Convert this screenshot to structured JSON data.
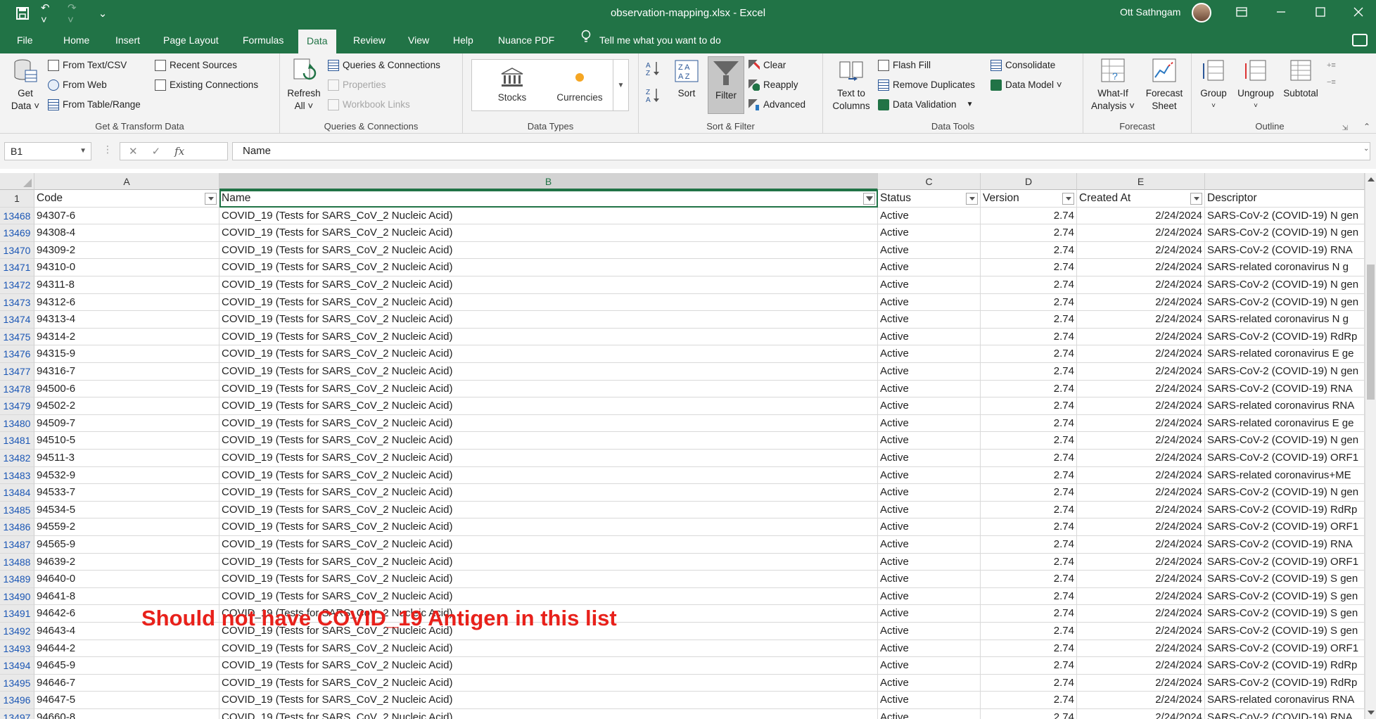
{
  "titlebar": {
    "document_title": "observation-mapping.xlsx  -  Excel",
    "user_name": "Ott Sathngam",
    "qat_icons": [
      "save-icon",
      "undo-icon",
      "redo-icon",
      "customize-qat-icon"
    ]
  },
  "tabs": [
    "File",
    "Home",
    "Insert",
    "Page Layout",
    "Formulas",
    "Data",
    "Review",
    "View",
    "Help",
    "Nuance PDF"
  ],
  "active_tab": "Data",
  "tell_me": "Tell me what you want to do",
  "ribbon": {
    "get_transform": {
      "get_data_line1": "Get",
      "get_data_line2": "Data ˅",
      "from_text_csv": "From Text/CSV",
      "from_web": "From Web",
      "from_table_range": "From Table/Range",
      "recent_sources": "Recent Sources",
      "existing_connections": "Existing Connections",
      "label": "Get & Transform Data"
    },
    "queries": {
      "refresh_line1": "Refresh",
      "refresh_line2": "All ˅",
      "queries_connections": "Queries & Connections",
      "properties": "Properties",
      "workbook_links": "Workbook Links",
      "label": "Queries & Connections"
    },
    "data_types": {
      "stocks": "Stocks",
      "currencies": "Currencies",
      "label": "Data Types"
    },
    "sort_filter": {
      "sort": "Sort",
      "filter": "Filter",
      "clear": "Clear",
      "reapply": "Reapply",
      "advanced": "Advanced",
      "label": "Sort & Filter"
    },
    "data_tools": {
      "text_to_columns_line1": "Text to",
      "text_to_columns_line2": "Columns",
      "flash_fill": "Flash Fill",
      "remove_duplicates": "Remove Duplicates",
      "data_validation": "Data Validation",
      "consolidate": "Consolidate",
      "data_model": "Data Model ˅",
      "label": "Data Tools"
    },
    "forecast": {
      "what_if_line1": "What-If",
      "what_if_line2": "Analysis ˅",
      "forecast_sheet_line1": "Forecast",
      "forecast_sheet_line2": "Sheet",
      "label": "Forecast"
    },
    "outline": {
      "group": "Group",
      "ungroup": "Ungroup",
      "subtotal": "Subtotal",
      "label": "Outline"
    }
  },
  "formula_bar": {
    "name_box": "B1",
    "fx": "fx",
    "formula": "Name"
  },
  "columns": [
    "A",
    "B",
    "C",
    "D",
    "E"
  ],
  "header_row": {
    "row_number": "1",
    "cells": [
      "Code",
      "Name",
      "Status",
      "Version",
      "Created At",
      "Descriptor"
    ]
  },
  "rows": [
    {
      "n": "13468",
      "code": "94307-6",
      "name": "COVID_19 (Tests for SARS_CoV_2 Nucleic Acid)",
      "status": "Active",
      "version": "2.74",
      "created": "2/24/2024",
      "descriptor": "SARS-CoV-2 (COVID-19) N gen"
    },
    {
      "n": "13469",
      "code": "94308-4",
      "name": "COVID_19 (Tests for SARS_CoV_2 Nucleic Acid)",
      "status": "Active",
      "version": "2.74",
      "created": "2/24/2024",
      "descriptor": "SARS-CoV-2 (COVID-19) N gen"
    },
    {
      "n": "13470",
      "code": "94309-2",
      "name": "COVID_19 (Tests for SARS_CoV_2 Nucleic Acid)",
      "status": "Active",
      "version": "2.74",
      "created": "2/24/2024",
      "descriptor": "SARS-CoV-2 (COVID-19) RNA"
    },
    {
      "n": "13471",
      "code": "94310-0",
      "name": "COVID_19 (Tests for SARS_CoV_2 Nucleic Acid)",
      "status": "Active",
      "version": "2.74",
      "created": "2/24/2024",
      "descriptor": "SARS-related coronavirus N g"
    },
    {
      "n": "13472",
      "code": "94311-8",
      "name": "COVID_19 (Tests for SARS_CoV_2 Nucleic Acid)",
      "status": "Active",
      "version": "2.74",
      "created": "2/24/2024",
      "descriptor": "SARS-CoV-2 (COVID-19) N gen"
    },
    {
      "n": "13473",
      "code": "94312-6",
      "name": "COVID_19 (Tests for SARS_CoV_2 Nucleic Acid)",
      "status": "Active",
      "version": "2.74",
      "created": "2/24/2024",
      "descriptor": "SARS-CoV-2 (COVID-19) N gen"
    },
    {
      "n": "13474",
      "code": "94313-4",
      "name": "COVID_19 (Tests for SARS_CoV_2 Nucleic Acid)",
      "status": "Active",
      "version": "2.74",
      "created": "2/24/2024",
      "descriptor": "SARS-related coronavirus N g"
    },
    {
      "n": "13475",
      "code": "94314-2",
      "name": "COVID_19 (Tests for SARS_CoV_2 Nucleic Acid)",
      "status": "Active",
      "version": "2.74",
      "created": "2/24/2024",
      "descriptor": "SARS-CoV-2 (COVID-19) RdRp"
    },
    {
      "n": "13476",
      "code": "94315-9",
      "name": "COVID_19 (Tests for SARS_CoV_2 Nucleic Acid)",
      "status": "Active",
      "version": "2.74",
      "created": "2/24/2024",
      "descriptor": "SARS-related coronavirus E ge"
    },
    {
      "n": "13477",
      "code": "94316-7",
      "name": "COVID_19 (Tests for SARS_CoV_2 Nucleic Acid)",
      "status": "Active",
      "version": "2.74",
      "created": "2/24/2024",
      "descriptor": "SARS-CoV-2 (COVID-19) N gen"
    },
    {
      "n": "13478",
      "code": "94500-6",
      "name": "COVID_19 (Tests for SARS_CoV_2 Nucleic Acid)",
      "status": "Active",
      "version": "2.74",
      "created": "2/24/2024",
      "descriptor": "SARS-CoV-2 (COVID-19) RNA"
    },
    {
      "n": "13479",
      "code": "94502-2",
      "name": "COVID_19 (Tests for SARS_CoV_2 Nucleic Acid)",
      "status": "Active",
      "version": "2.74",
      "created": "2/24/2024",
      "descriptor": "SARS-related coronavirus RNA"
    },
    {
      "n": "13480",
      "code": "94509-7",
      "name": "COVID_19 (Tests for SARS_CoV_2 Nucleic Acid)",
      "status": "Active",
      "version": "2.74",
      "created": "2/24/2024",
      "descriptor": "SARS-related coronavirus E ge"
    },
    {
      "n": "13481",
      "code": "94510-5",
      "name": "COVID_19 (Tests for SARS_CoV_2 Nucleic Acid)",
      "status": "Active",
      "version": "2.74",
      "created": "2/24/2024",
      "descriptor": "SARS-CoV-2 (COVID-19) N gen"
    },
    {
      "n": "13482",
      "code": "94511-3",
      "name": "COVID_19 (Tests for SARS_CoV_2 Nucleic Acid)",
      "status": "Active",
      "version": "2.74",
      "created": "2/24/2024",
      "descriptor": "SARS-CoV-2 (COVID-19) ORF1"
    },
    {
      "n": "13483",
      "code": "94532-9",
      "name": "COVID_19 (Tests for SARS_CoV_2 Nucleic Acid)",
      "status": "Active",
      "version": "2.74",
      "created": "2/24/2024",
      "descriptor": "SARS-related coronavirus+ME"
    },
    {
      "n": "13484",
      "code": "94533-7",
      "name": "COVID_19 (Tests for SARS_CoV_2 Nucleic Acid)",
      "status": "Active",
      "version": "2.74",
      "created": "2/24/2024",
      "descriptor": "SARS-CoV-2 (COVID-19) N gen"
    },
    {
      "n": "13485",
      "code": "94534-5",
      "name": "COVID_19 (Tests for SARS_CoV_2 Nucleic Acid)",
      "status": "Active",
      "version": "2.74",
      "created": "2/24/2024",
      "descriptor": "SARS-CoV-2 (COVID-19) RdRp"
    },
    {
      "n": "13486",
      "code": "94559-2",
      "name": "COVID_19 (Tests for SARS_CoV_2 Nucleic Acid)",
      "status": "Active",
      "version": "2.74",
      "created": "2/24/2024",
      "descriptor": "SARS-CoV-2 (COVID-19) ORF1"
    },
    {
      "n": "13487",
      "code": "94565-9",
      "name": "COVID_19 (Tests for SARS_CoV_2 Nucleic Acid)",
      "status": "Active",
      "version": "2.74",
      "created": "2/24/2024",
      "descriptor": "SARS-CoV-2 (COVID-19) RNA"
    },
    {
      "n": "13488",
      "code": "94639-2",
      "name": "COVID_19 (Tests for SARS_CoV_2 Nucleic Acid)",
      "status": "Active",
      "version": "2.74",
      "created": "2/24/2024",
      "descriptor": "SARS-CoV-2 (COVID-19) ORF1"
    },
    {
      "n": "13489",
      "code": "94640-0",
      "name": "COVID_19 (Tests for SARS_CoV_2 Nucleic Acid)",
      "status": "Active",
      "version": "2.74",
      "created": "2/24/2024",
      "descriptor": "SARS-CoV-2 (COVID-19) S gen"
    },
    {
      "n": "13490",
      "code": "94641-8",
      "name": "COVID_19 (Tests for SARS_CoV_2 Nucleic Acid)",
      "status": "Active",
      "version": "2.74",
      "created": "2/24/2024",
      "descriptor": "SARS-CoV-2 (COVID-19) S gen"
    },
    {
      "n": "13491",
      "code": "94642-6",
      "name": "COVID_19 (Tests for SARS_CoV_2 Nucleic Acid)",
      "status": "Active",
      "version": "2.74",
      "created": "2/24/2024",
      "descriptor": "SARS-CoV-2 (COVID-19) S gen"
    },
    {
      "n": "13492",
      "code": "94643-4",
      "name": "COVID_19 (Tests for SARS_CoV_2 Nucleic Acid)",
      "status": "Active",
      "version": "2.74",
      "created": "2/24/2024",
      "descriptor": "SARS-CoV-2 (COVID-19) S gen"
    },
    {
      "n": "13493",
      "code": "94644-2",
      "name": "COVID_19 (Tests for SARS_CoV_2 Nucleic Acid)",
      "status": "Active",
      "version": "2.74",
      "created": "2/24/2024",
      "descriptor": "SARS-CoV-2 (COVID-19) ORF1"
    },
    {
      "n": "13494",
      "code": "94645-9",
      "name": "COVID_19 (Tests for SARS_CoV_2 Nucleic Acid)",
      "status": "Active",
      "version": "2.74",
      "created": "2/24/2024",
      "descriptor": "SARS-CoV-2 (COVID-19) RdRp"
    },
    {
      "n": "13495",
      "code": "94646-7",
      "name": "COVID_19 (Tests for SARS_CoV_2 Nucleic Acid)",
      "status": "Active",
      "version": "2.74",
      "created": "2/24/2024",
      "descriptor": "SARS-CoV-2 (COVID-19) RdRp"
    },
    {
      "n": "13496",
      "code": "94647-5",
      "name": "COVID_19 (Tests for SARS_CoV_2 Nucleic Acid)",
      "status": "Active",
      "version": "2.74",
      "created": "2/24/2024",
      "descriptor": "SARS-related coronavirus RNA"
    },
    {
      "n": "13497",
      "code": "94660-8",
      "name": "COVID_19 (Tests for SARS_CoV_2 Nucleic Acid)",
      "status": "Active",
      "version": "2.74",
      "created": "2/24/2024",
      "descriptor": "SARS-CoV-2 (COVID-19) RNA"
    }
  ],
  "annotation": "Should not have COVID_19 Antigen in this list",
  "colors": {
    "excel_green": "#217346",
    "annotation_red": "#e8211b",
    "row_number_blue": "#1c57b5"
  }
}
